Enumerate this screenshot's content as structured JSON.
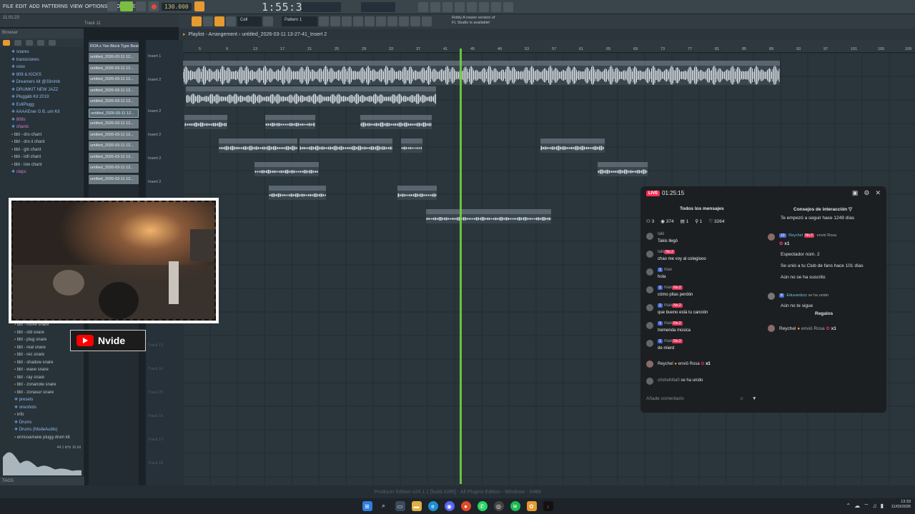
{
  "menu": [
    "FILE",
    "EDIT",
    "ADD",
    "PATTERNS",
    "VIEW",
    "OPTIONS",
    "TOOLS",
    "HELP"
  ],
  "hint": {
    "time": "11:01:23",
    "track": "Track 11"
  },
  "transport": {
    "tempo": "130.000",
    "song_time": "1:55:32"
  },
  "pattern_selector": "Pattern 1",
  "snap": "Cell",
  "news": {
    "line1": "Robly  A newer version of",
    "line2": "FL Studio is available!"
  },
  "browser": {
    "title": "Browser",
    "items": [
      {
        "label": "snares",
        "type": "folder"
      },
      {
        "label": "transiciones",
        "type": "folder"
      },
      {
        "label": "voxx",
        "type": "folder"
      },
      {
        "label": "808 & KICKS",
        "type": "folder"
      },
      {
        "label": "Dreamers kit @33nimb",
        "type": "folder"
      },
      {
        "label": "DRUMKIT NEW JAZZ",
        "type": "folder"
      },
      {
        "label": "Pluggäb Kit 2019",
        "type": "folder"
      },
      {
        "label": "EvilPlugg",
        "type": "folder"
      },
      {
        "label": "AAAAEner G B..um Kit",
        "type": "folder"
      },
      {
        "label": "808s",
        "type": "active"
      },
      {
        "label": "chants",
        "type": "active"
      },
      {
        "label": "bbl - dro chant",
        "type": "file"
      },
      {
        "label": "bbl - dro ii chant",
        "type": "file"
      },
      {
        "label": "bbl - glo chant",
        "type": "file"
      },
      {
        "label": "bbl - lofi chant",
        "type": "file"
      },
      {
        "label": "bbl - low chant",
        "type": "file"
      },
      {
        "label": "claps",
        "type": "active"
      }
    ],
    "items_lower": [
      {
        "label": "bbl - move snare",
        "type": "file"
      },
      {
        "label": "bbl - old snare",
        "type": "file"
      },
      {
        "label": "bbl - plug snare",
        "type": "file"
      },
      {
        "label": "bbl - real snare",
        "type": "file"
      },
      {
        "label": "bbl - rec snare",
        "type": "file"
      },
      {
        "label": "bbl - shadow snare",
        "type": "file"
      },
      {
        "label": "bbl - wave snare",
        "type": "file"
      },
      {
        "label": "bbl - ray snare",
        "type": "file"
      },
      {
        "label": "bbl - zonanote snare",
        "type": "file"
      },
      {
        "label": "bbl - zonasur snare",
        "type": "file"
      },
      {
        "label": "presets",
        "type": "folder"
      },
      {
        "label": "oneshots",
        "type": "folder"
      },
      {
        "label": "info",
        "type": "file"
      },
      {
        "label": "Drums",
        "type": "folder"
      },
      {
        "label": "Drums (ModeAudio)",
        "type": "folder"
      },
      {
        "label": "enricoamane plugg drum kit",
        "type": "file"
      }
    ],
    "preview_info": "44.1 kHz 16 bit",
    "footer": "TAGS"
  },
  "playlist": {
    "title": "Playlist - Arrangement › untitled_2026-03-11 13-27-41_Insert 2",
    "patterns": [
      "ROA x Yan Block Type Beat",
      "untitled_2026-03-11 12...",
      "untitled_2026-03-11 12...",
      "untitled_2026-03-11 12...",
      "untitled_2026-03-11 12...",
      "untitled_2026-03-11 12...",
      "untitled_2026-03-11 12...",
      "untitled_2026-03-11 12...",
      "untitled_2026-03-11 12...",
      "untitled_2026-03-11 12...",
      "untitled_2026-03-11 12...",
      "untitled_2026-03-11 12...",
      "untitled_2026-03-11 12..."
    ],
    "tracks": [
      "Insert 1",
      "Insert 2",
      "Insert 2",
      "Insert 2",
      "Insert 2",
      "Insert 2",
      "Track 13",
      "Track 16",
      "Track 25",
      "Track 16",
      "Track 17",
      "Track 18"
    ],
    "ruler": [
      "5",
      "9",
      "13",
      "17",
      "21",
      "25",
      "29",
      "33",
      "37",
      "41",
      "45",
      "49",
      "53",
      "57",
      "61",
      "65",
      "69",
      "73",
      "77",
      "81",
      "85",
      "89",
      "93",
      "97",
      "101",
      "105",
      "109"
    ],
    "clips": [
      "ROA x Yan Block Type Beat - BLAM BLAM - Yuukai",
      "untitled_2026-03-11 12-18-14_Insert 2",
      "untitled_2...Insert 2",
      "untitled_2026-...0-27_Insert 2",
      "untitled_2026-...26_Insert 2",
      "untitled_2026-03-11-48_Insert 2",
      "untitl...rt 2",
      "untitled_2026-03-...34-40_Insert 2",
      "untitled_2026-...30_Insert 2",
      "untitled_2026-...0-09-27_Insert 2",
      "untitled_2...Insert 2",
      "untitled...Insert 2",
      "untitled_2026-03-11 13-27-41_Insert 2"
    ]
  },
  "status_bar": "Producer Edition v24.1.1 [build 4285] - All Plugins Edition - Windows - 64Bit",
  "overlay": {
    "channel_name": "Nvide"
  },
  "tiktok_live": {
    "badge": "LIVE",
    "duration": "01:25:15",
    "left_title": "Todos los mensajes",
    "right_title": "Consejos de interacción",
    "stats": {
      "rank": "3",
      "viewers": "374",
      "gifts": "1",
      "shares": "1",
      "likes": "3264"
    },
    "messages": [
      {
        "user": "taki",
        "badges": [],
        "text": "Takis llegó"
      },
      {
        "user": "taki",
        "badges": [
          "No.2"
        ],
        "text": "chao me voy al colegiooo"
      },
      {
        "user": "max",
        "badges": [
          "1"
        ],
        "text": "hola"
      },
      {
        "user": "max",
        "badges": [
          "1",
          "No.2"
        ],
        "text": "cómo pitas perdón"
      },
      {
        "user": "max",
        "badges": [
          "1",
          "No.2"
        ],
        "text": "que bueno está tu canción"
      },
      {
        "user": "max",
        "badges": [
          "1",
          "No.2"
        ],
        "text": "tremenda música"
      },
      {
        "user": "max",
        "badges": [
          "1",
          "No.2"
        ],
        "text": "de mierd"
      }
    ],
    "gift_line": {
      "user": "Reychel",
      "action": "envió Rosa",
      "count": "x1"
    },
    "join_line": {
      "user": "crishuhiha0",
      "action": "se ha unido"
    },
    "comment_placeholder": "Añade comentario",
    "right": {
      "follow": "Te empezó a seguir hace 1249 días",
      "user_card": {
        "level": "10",
        "user": "Reychel",
        "badge": "No.2",
        "action": "envió Rosa",
        "count": "x1"
      },
      "spectator": "Espectador núm. 2",
      "fanclub": "Se unió a tu Club de fans hace 101 días",
      "subscribe": "Aún no se ha suscrito",
      "join": {
        "level": "8",
        "user": "Eduxardzzz",
        "action": "se ha unido"
      },
      "not_follow": "Aún no te sigue",
      "gifts_title": "Regalos",
      "gift": {
        "user": "Reychel",
        "action": "envió Rosa",
        "count": "x1"
      }
    }
  },
  "system_tray": {
    "time": "13:33",
    "date": "11/03/2026"
  },
  "colors": {
    "playhead": "#74d23b",
    "live_accent": "#fe2c55",
    "yt_red": "#ff0000",
    "browser_active": "#d07ad9",
    "folder": "#8fb9e6"
  }
}
